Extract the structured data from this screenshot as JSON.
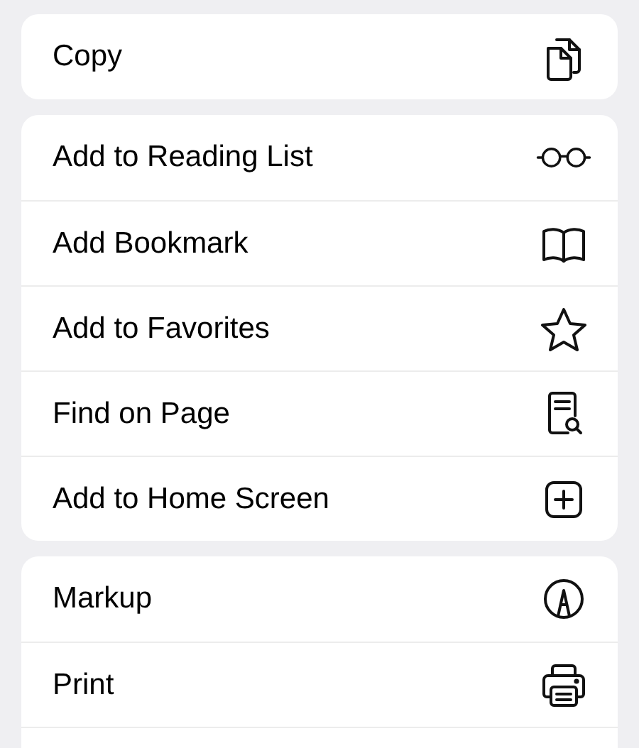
{
  "groups": [
    {
      "items": [
        {
          "label": "Copy",
          "kind": "copy"
        }
      ]
    },
    {
      "items": [
        {
          "label": "Add to Reading List",
          "kind": "glasses"
        },
        {
          "label": "Add Bookmark",
          "kind": "book"
        },
        {
          "label": "Add to Favorites",
          "kind": "star"
        },
        {
          "label": "Find on Page",
          "kind": "find"
        },
        {
          "label": "Add to Home Screen",
          "kind": "add"
        }
      ]
    },
    {
      "items": [
        {
          "label": "Markup",
          "kind": "markup"
        },
        {
          "label": "Print",
          "kind": "print"
        }
      ]
    }
  ]
}
